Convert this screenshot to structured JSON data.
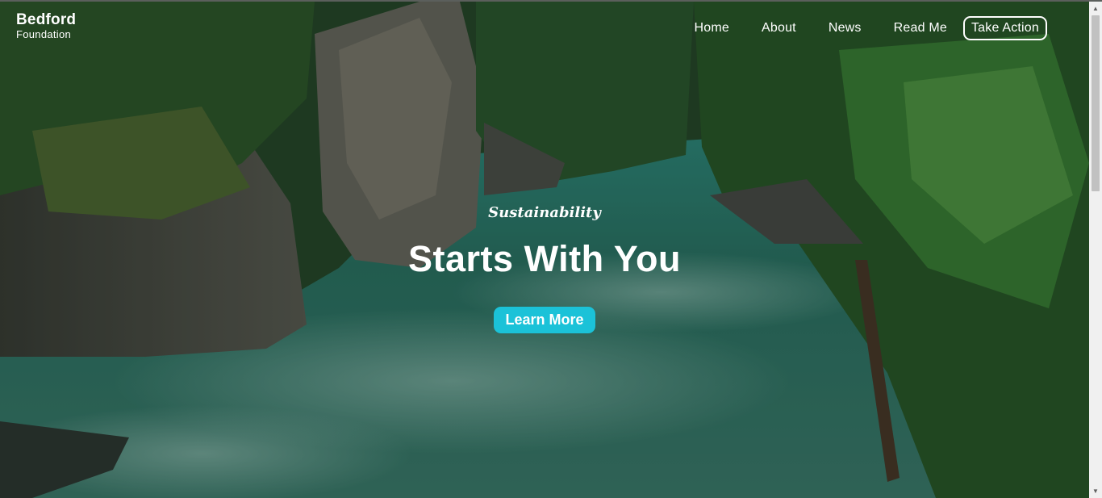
{
  "brand": {
    "name": "Bedford",
    "sub": "Foundation"
  },
  "nav": {
    "items": [
      {
        "label": "Home"
      },
      {
        "label": "About"
      },
      {
        "label": "News"
      },
      {
        "label": "Read Me"
      }
    ],
    "cta": "Take Action"
  },
  "hero": {
    "kicker": "Sustainability",
    "headline": "Starts With You",
    "button": "Learn More",
    "accent_color": "#1bc2d8",
    "background": "forest river canyon photo"
  },
  "scrollbar": {
    "up_icon": "triangle-up",
    "down_icon": "triangle-down"
  }
}
